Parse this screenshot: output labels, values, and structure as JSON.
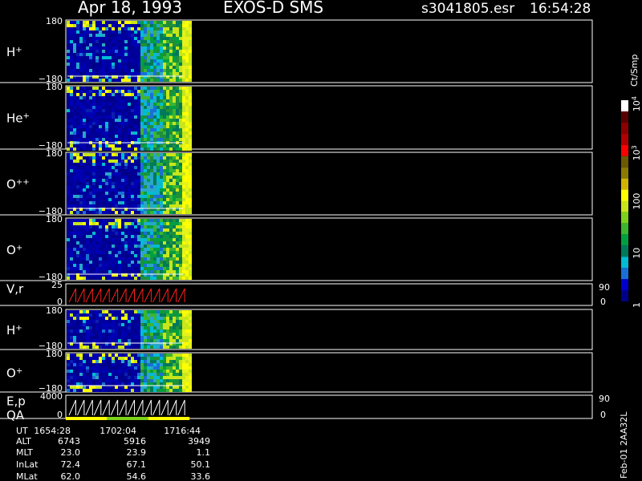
{
  "header": {
    "date": "Apr 18, 1993",
    "instrument": "EXOS-D SMS",
    "file": "s3041805.esr",
    "time": "16:54:28"
  },
  "colorbar": {
    "unit": "Ct/Smp",
    "ticks": [
      "1",
      "10",
      "100",
      "10",
      "10"
    ],
    "tick_exponents": [
      "",
      "",
      "",
      "3",
      "4"
    ],
    "tick_values": [
      1,
      10,
      100,
      1000,
      10000
    ],
    "colors": [
      "#00008b",
      "#0000cd",
      "#1a6fd6",
      "#00bcd4",
      "#007a5a",
      "#00a040",
      "#3cb531",
      "#7cd11a",
      "#c8e61a",
      "#ffff00",
      "#d2b400",
      "#8b7a00",
      "#6b5a00",
      "#ff0000",
      "#b00000",
      "#8b0000",
      "#5a0000",
      "#ffffff"
    ]
  },
  "footer": {
    "side_label": "Feb-01 2AA32L",
    "row_labels": [
      "UT",
      "ALT",
      "MLT",
      "InLat",
      "MLat"
    ],
    "columns": [
      [
        "1654:28",
        "6743",
        "23.0",
        "72.4",
        "62.0"
      ],
      [
        "1702:04",
        "5916",
        "23.9",
        "67.1",
        "54.6"
      ],
      [
        "1716:44",
        "3949",
        "1.1",
        "50.1",
        "33.6"
      ]
    ]
  },
  "chart_data": {
    "type": "heatmap",
    "title": "Apr 18, 1993   EXOS-D SMS",
    "x_unit": "UT",
    "x_times": [
      "1654:28",
      "1702:04",
      "1716:44"
    ],
    "data_coverage_fraction": 0.235,
    "panels": [
      {
        "id": "h1",
        "label": "H",
        "sup": "+",
        "ylim": [
          -180,
          180
        ],
        "ytick_top": "180",
        "ytick_bottom": "−180",
        "right_ticks": []
      },
      {
        "id": "he1",
        "label": "He",
        "sup": "+",
        "ylim": [
          -180,
          180
        ],
        "ytick_top": "180",
        "ytick_bottom": "−180",
        "right_ticks": []
      },
      {
        "id": "opp",
        "label": "O",
        "sup": "++",
        "ylim": [
          -180,
          180
        ],
        "ytick_top": "180",
        "ytick_bottom": "−180",
        "right_ticks": []
      },
      {
        "id": "op1",
        "label": "O",
        "sup": "+",
        "ylim": [
          -180,
          180
        ],
        "ytick_top": "180",
        "ytick_bottom": "−180",
        "right_ticks": []
      },
      {
        "id": "vr",
        "label": "V,r",
        "sup": "",
        "ylim": [
          0,
          25
        ],
        "ytick_top": "25",
        "ytick_bottom": "0",
        "right_ticks": [
          "90",
          "0"
        ],
        "line": true
      },
      {
        "id": "h2",
        "label": "H",
        "sup": "+",
        "ylim": [
          -180,
          180
        ],
        "ytick_top": "180",
        "ytick_bottom": "−180",
        "right_ticks": []
      },
      {
        "id": "op2",
        "label": "O",
        "sup": "+",
        "ylim": [
          -180,
          180
        ],
        "ytick_top": "180",
        "ytick_bottom": "−180",
        "right_ticks": []
      },
      {
        "id": "ep",
        "label": "E,p",
        "sup": "",
        "ylim": [
          0,
          4000
        ],
        "ytick_top": "4000",
        "ytick_bottom": "0",
        "right_ticks": [
          "90",
          "0"
        ],
        "line": true,
        "second_label": "QA"
      }
    ],
    "qa_bar": [
      "#ffff00",
      "#7cd11a",
      "#ffff00"
    ]
  }
}
